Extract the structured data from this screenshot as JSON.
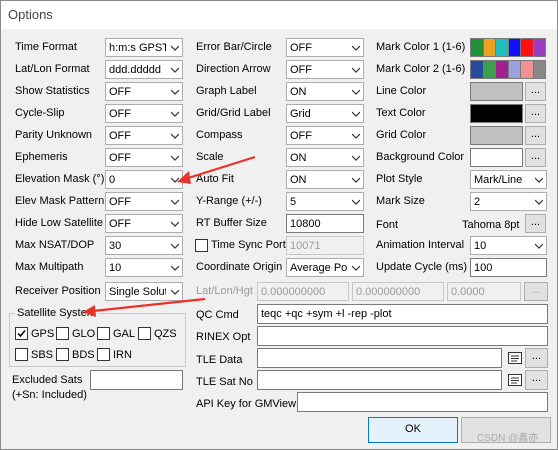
{
  "window": {
    "title": "Options"
  },
  "col1": {
    "time_format": {
      "label": "Time Format",
      "value": "h:m:s GPST"
    },
    "latlon_format": {
      "label": "Lat/Lon Format",
      "value": "ddd.ddddd"
    },
    "show_statistics": {
      "label": "Show Statistics",
      "value": "OFF"
    },
    "cycle_slip": {
      "label": "Cycle-Slip",
      "value": "OFF"
    },
    "parity_unknown": {
      "label": "Parity Unknown",
      "value": "OFF"
    },
    "ephemeris": {
      "label": "Ephemeris",
      "value": "OFF"
    },
    "elevation_mask": {
      "label": "Elevation Mask (°)",
      "value": "0"
    },
    "elev_mask_pattern": {
      "label": "Elev Mask Pattern",
      "value": "OFF"
    },
    "hide_low_satellite": {
      "label": "Hide Low Satellite",
      "value": "OFF"
    },
    "max_nsat_dop": {
      "label": "Max NSAT/DOP",
      "value": "30"
    },
    "max_multipath": {
      "label": "Max Multipath",
      "value": "10"
    },
    "receiver_position": {
      "label": "Receiver Position",
      "value": "Single Solution"
    }
  },
  "col2": {
    "error_bar": {
      "label": "Error Bar/Circle",
      "value": "OFF"
    },
    "direction_arrow": {
      "label": "Direction Arrow",
      "value": "OFF"
    },
    "graph_label": {
      "label": "Graph Label",
      "value": "ON"
    },
    "grid_label": {
      "label": "Grid/Grid Label",
      "value": "Grid"
    },
    "compass": {
      "label": "Compass",
      "value": "OFF"
    },
    "scale": {
      "label": "Scale",
      "value": "ON"
    },
    "auto_fit": {
      "label": "Auto Fit",
      "value": "ON"
    },
    "y_range": {
      "label": "Y-Range (+/-)",
      "value": "5"
    },
    "rt_buffer": {
      "label": "RT Buffer Size",
      "value": "10800"
    },
    "time_sync": {
      "label": "Time Sync Port",
      "value": "10071"
    },
    "coord_origin": {
      "label": "Coordinate Origin",
      "value": "Average Position"
    },
    "latlonhgt": {
      "label": "Lat/Lon/Hgt",
      "lat": "0.000000000",
      "lon": "0.000000000",
      "hgt": "0.0000"
    }
  },
  "col3": {
    "mark_color1": {
      "label": "Mark Color 1 (1-6)",
      "colors": [
        "#1f8f3a",
        "#f0a020",
        "#1fbfbf",
        "#1010ff",
        "#ff1010",
        "#9a3dbf"
      ]
    },
    "mark_color2": {
      "label": "Mark Color 2 (1-6)",
      "colors": [
        "#284a9a",
        "#3aa04a",
        "#a02090",
        "#9aa0e0",
        "#f09090",
        "#888888"
      ]
    },
    "line_color": {
      "label": "Line Color",
      "color": "#c0c0c0"
    },
    "text_color": {
      "label": "Text Color",
      "color": "#000000"
    },
    "grid_color": {
      "label": "Grid Color",
      "color": "#c0c0c0"
    },
    "background_color": {
      "label": "Background Color",
      "color": "#ffffff"
    },
    "plot_style": {
      "label": "Plot Style",
      "value": "Mark/Line"
    },
    "mark_size": {
      "label": "Mark Size",
      "value": "2"
    },
    "font": {
      "label": "Font",
      "value": "Tahoma 8pt"
    },
    "animation_interval": {
      "label": "Animation Interval",
      "value": "10"
    },
    "update_cycle": {
      "label": "Update Cycle (ms)",
      "value": "100"
    },
    "dots": "..."
  },
  "satellite_system": {
    "title": "Satellite System",
    "systems": [
      {
        "name": "GPS",
        "checked": true
      },
      {
        "name": "GLO",
        "checked": false
      },
      {
        "name": "GAL",
        "checked": false
      },
      {
        "name": "QZS",
        "checked": false
      },
      {
        "name": "SBS",
        "checked": false
      },
      {
        "name": "BDS",
        "checked": false
      },
      {
        "name": "IRN",
        "checked": false
      }
    ]
  },
  "excluded_sats": {
    "label1": "Excluded Sats",
    "label2": "(+Sn: Included)",
    "value": ""
  },
  "qc_cmd": {
    "label": "QC Cmd",
    "value": "teqc +qc +sym +l -rep -plot"
  },
  "rinex_opt": {
    "label": "RINEX Opt",
    "value": ""
  },
  "tle_data": {
    "label": "TLE Data",
    "value": ""
  },
  "tle_sat_no": {
    "label": "TLE Sat No",
    "value": ""
  },
  "api_key": {
    "label": "API Key for GMView",
    "value": ""
  },
  "ok_button": {
    "label": "OK"
  },
  "watermark": "CSDN @鑫亦",
  "colors": {
    "arrow_red": "#e8322a",
    "window_bg": "#f0f0f0"
  }
}
